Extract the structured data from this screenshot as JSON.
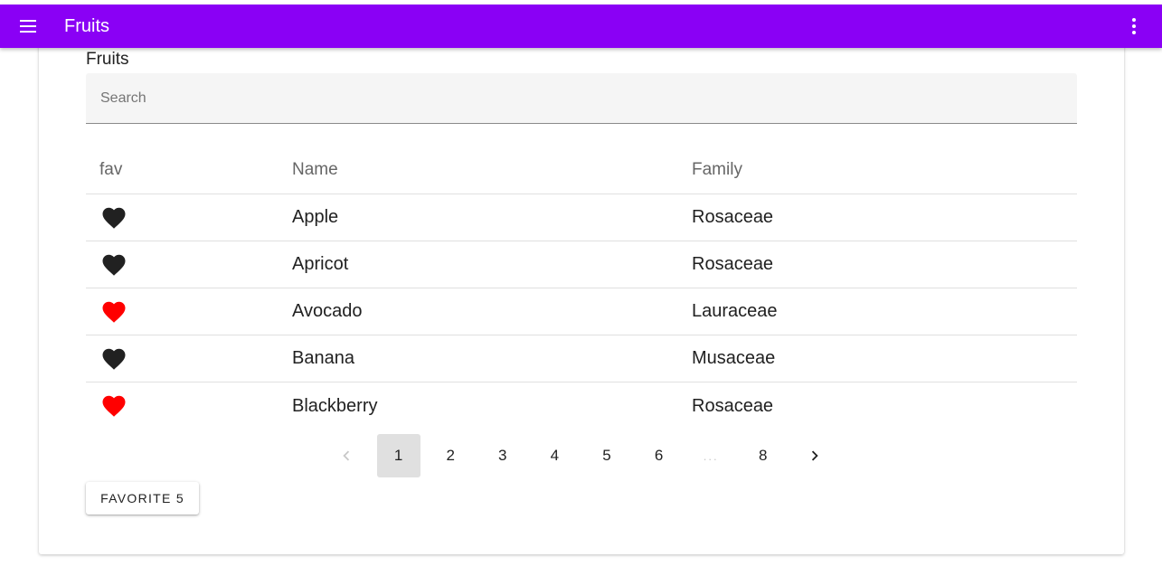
{
  "appbar": {
    "title": "Fruits",
    "menu_icon": "menu-icon",
    "more_icon": "more-vert-icon",
    "color": "#8a00f5"
  },
  "card": {
    "title": "Fruits",
    "search": {
      "placeholder": "Search",
      "value": ""
    }
  },
  "table": {
    "headers": {
      "fav": "fav",
      "name": "Name",
      "family": "Family"
    },
    "rows": [
      {
        "favorite": false,
        "name": "Apple",
        "family": "Rosaceae"
      },
      {
        "favorite": false,
        "name": "Apricot",
        "family": "Rosaceae"
      },
      {
        "favorite": true,
        "name": "Avocado",
        "family": "Lauraceae"
      },
      {
        "favorite": false,
        "name": "Banana",
        "family": "Musaceae"
      },
      {
        "favorite": true,
        "name": "Blackberry",
        "family": "Rosaceae"
      }
    ],
    "heart_colors": {
      "on": "#ff0000",
      "off": "#212121"
    }
  },
  "pagination": {
    "prev_icon": "chevron-left-icon",
    "next_icon": "chevron-right-icon",
    "pages": [
      "1",
      "2",
      "3",
      "4",
      "5",
      "6",
      "...",
      "8"
    ],
    "current": "1"
  },
  "favorite_button": {
    "label": "FAVORITE 5"
  }
}
